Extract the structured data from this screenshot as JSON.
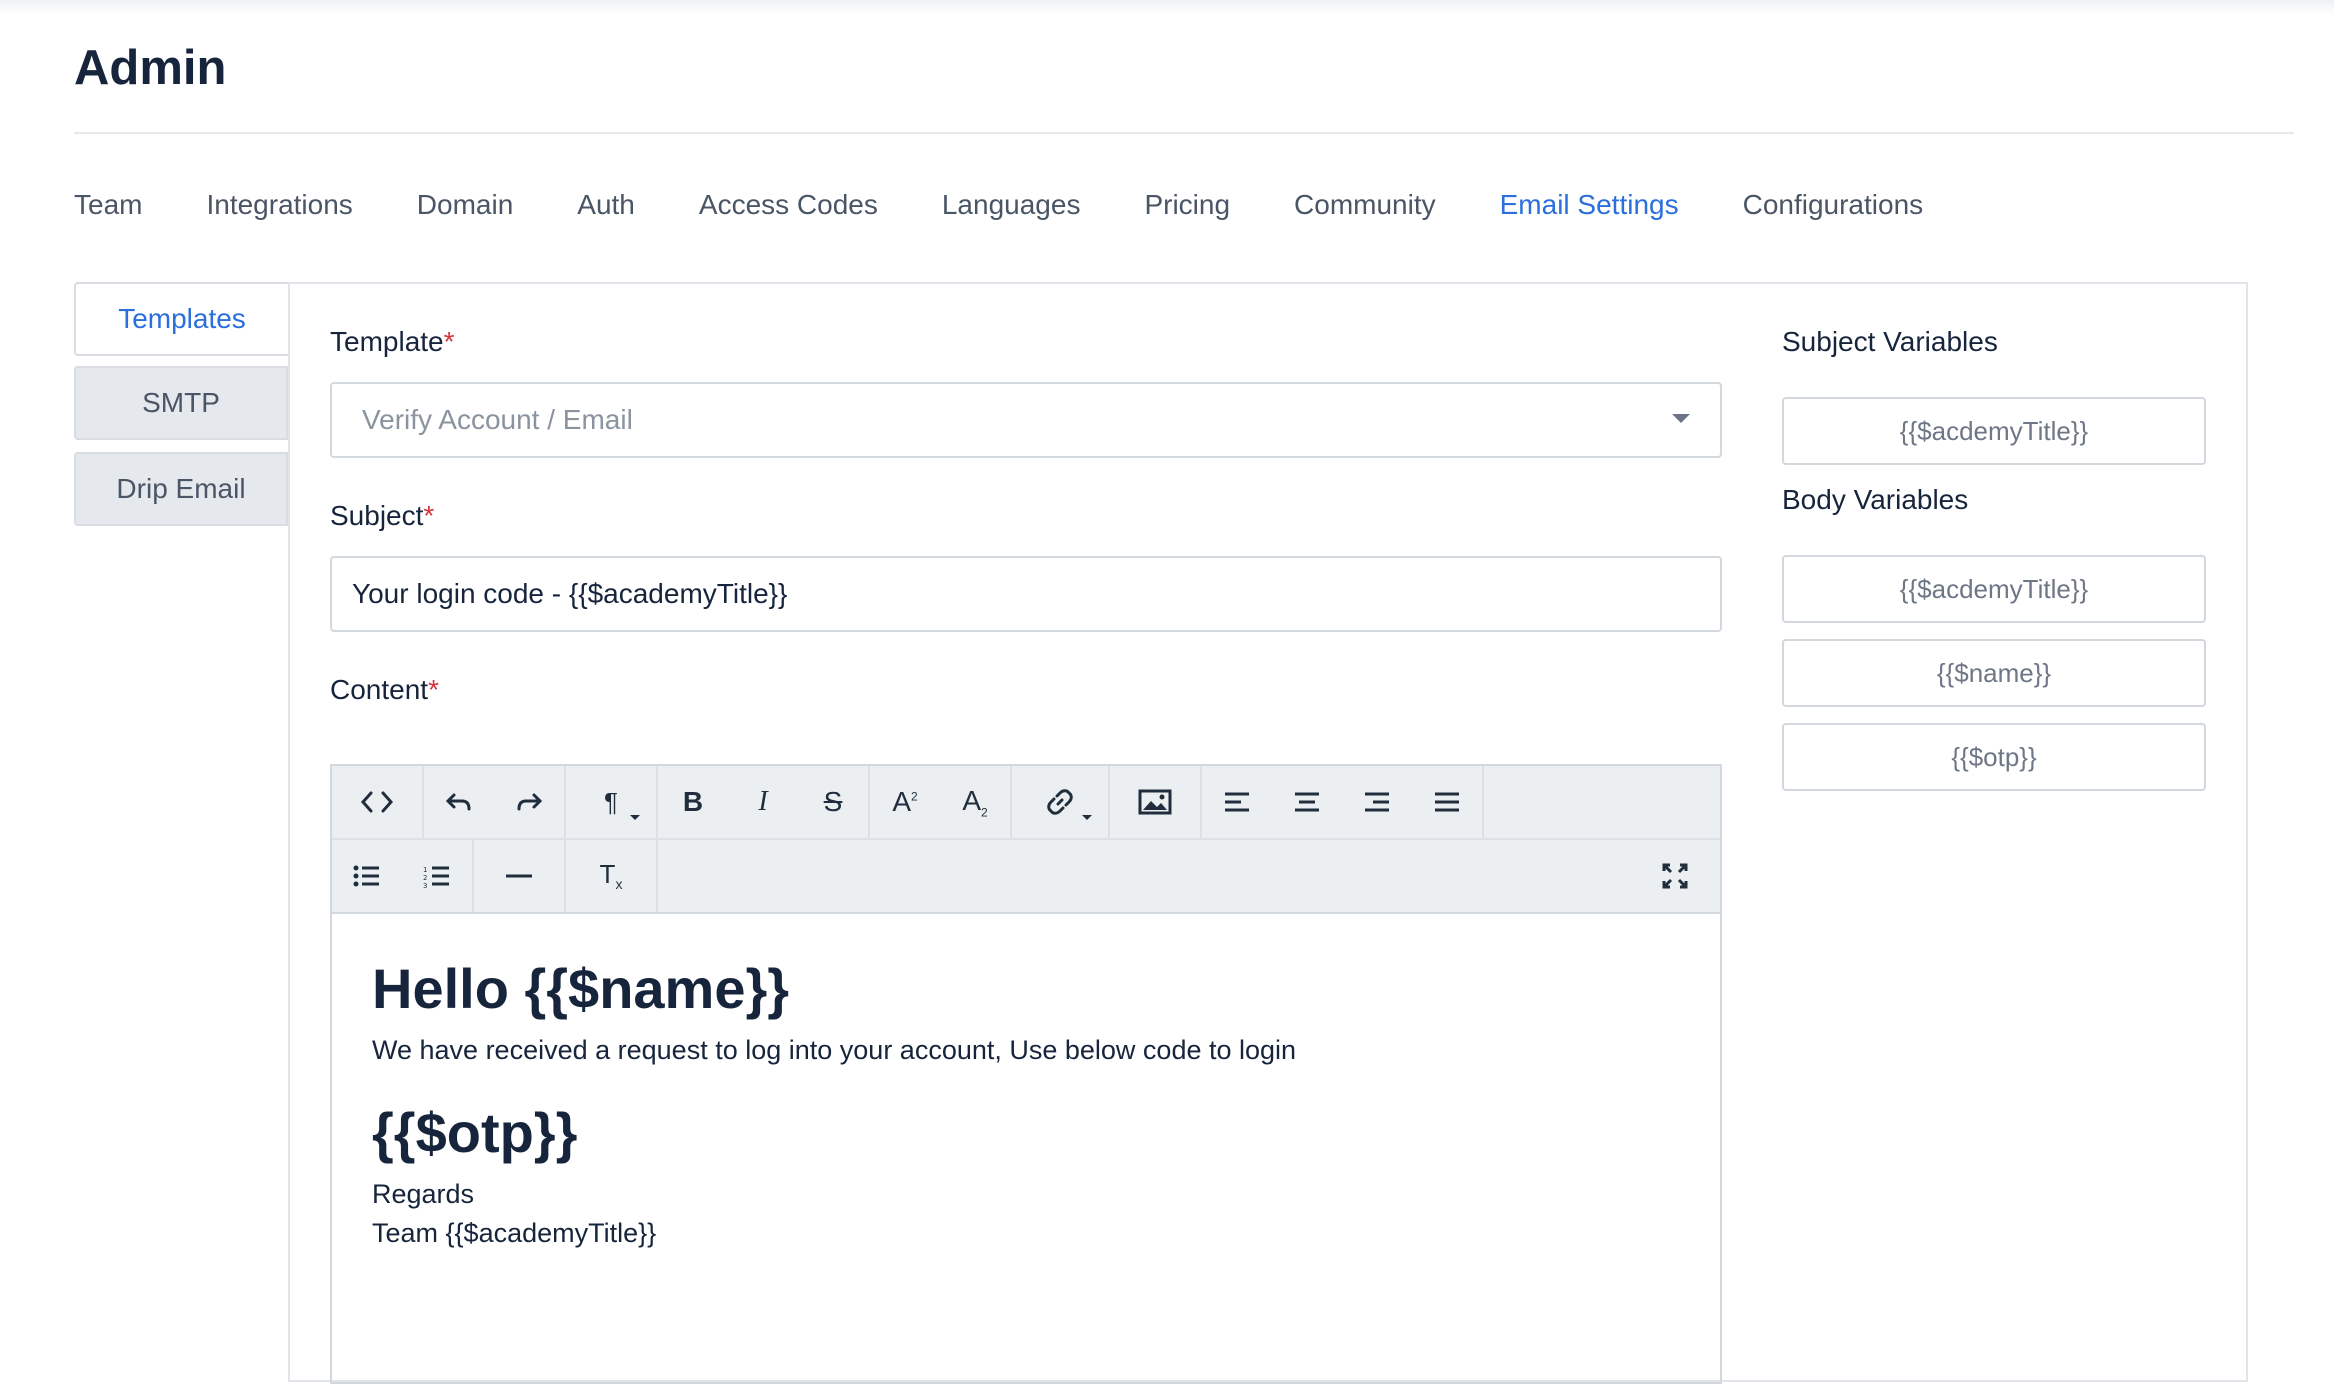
{
  "page": {
    "title": "Admin"
  },
  "tabs": [
    {
      "label": "Team"
    },
    {
      "label": "Integrations"
    },
    {
      "label": "Domain"
    },
    {
      "label": "Auth"
    },
    {
      "label": "Access Codes"
    },
    {
      "label": "Languages"
    },
    {
      "label": "Pricing"
    },
    {
      "label": "Community"
    },
    {
      "label": "Email Settings",
      "active": true
    },
    {
      "label": "Configurations"
    }
  ],
  "sidenav": [
    {
      "label": "Templates",
      "active": true
    },
    {
      "label": "SMTP"
    },
    {
      "label": "Drip Email"
    }
  ],
  "form": {
    "template_label": "Template",
    "template_value": "Verify Account / Email",
    "subject_label": "Subject",
    "subject_value": "Your login code - {{$academyTitle}}",
    "content_label": "Content",
    "required_mark": "*"
  },
  "toolbar": {
    "row1": [
      "code-view",
      "undo",
      "redo",
      "paragraph",
      "bold",
      "italic",
      "strikethrough",
      "superscript",
      "subscript",
      "link",
      "image",
      "align-left",
      "align-center",
      "align-right",
      "align-justify"
    ],
    "row2": [
      "bullet-list",
      "numbered-list",
      "horizontal-rule",
      "clear-format",
      "fullscreen"
    ]
  },
  "editor": {
    "heading1": "Hello {{$name}}",
    "paragraph": "We have received a request to log into your account, Use below code to login",
    "heading2": "{{$otp}}",
    "regards": "Regards",
    "team": "Team {{$academyTitle}}"
  },
  "variables": {
    "subject_title": "Subject Variables",
    "subject_vars": [
      "{{$acdemyTitle}}"
    ],
    "body_title": "Body Variables",
    "body_vars": [
      "{{$acdemyTitle}}",
      "{{$name}}",
      "{{$otp}}"
    ]
  },
  "colors": {
    "accent": "#2a6fdc",
    "required": "#d6333a"
  }
}
